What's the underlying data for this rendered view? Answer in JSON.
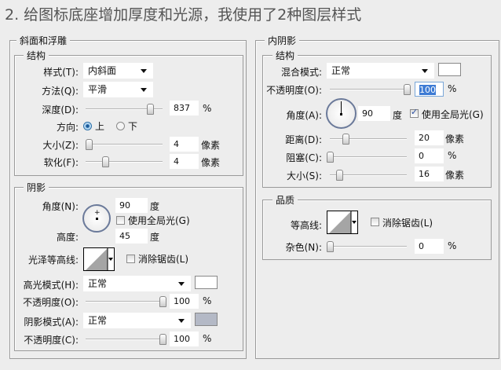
{
  "title": "2. 给图标底座增加厚度和光源，我使用了2种图层样式",
  "left": {
    "legend": "斜面和浮雕",
    "structure": {
      "legend": "结构",
      "style_label": "样式(T):",
      "style_value": "内斜面",
      "technique_label": "方法(Q):",
      "technique_value": "平滑",
      "depth_label": "深度(D):",
      "depth_value": "837",
      "depth_unit": "%",
      "depth_level": 0.84,
      "direction_label": "方向:",
      "direction_up": "上",
      "direction_down": "下",
      "direction_selected": "上",
      "size_label": "大小(Z):",
      "size_value": "4",
      "size_unit": "像素",
      "size_level": 0.04,
      "soften_label": "软化(F):",
      "soften_value": "4",
      "soften_unit": "像素",
      "soften_level": 0.26
    },
    "shading": {
      "legend": "阴影",
      "angle_label": "角度(N):",
      "angle_value": "90",
      "angle_unit": "度",
      "global_light_label": "使用全局光(G)",
      "global_light_checked": false,
      "altitude_label": "高度:",
      "altitude_value": "45",
      "altitude_unit": "度",
      "gloss_contour_label": "光泽等高线:",
      "antialias_label": "消除锯齿(L)",
      "antialias_checked": false,
      "highlight_mode_label": "高光模式(H):",
      "highlight_mode_value": "正常",
      "highlight_color": "#ffffff",
      "highlight_opacity_label": "不透明度(O):",
      "highlight_opacity_value": "100",
      "highlight_opacity_unit": "%",
      "highlight_opacity_level": 1.0,
      "shadow_mode_label": "阴影模式(A):",
      "shadow_mode_value": "正常",
      "shadow_color": "#b4b9c6",
      "shadow_opacity_label": "不透明度(C):",
      "shadow_opacity_value": "100",
      "shadow_opacity_unit": "%",
      "shadow_opacity_level": 1.0
    }
  },
  "right": {
    "legend": "内阴影",
    "structure": {
      "legend": "结构",
      "blend_label": "混合模式:",
      "blend_value": "正常",
      "blend_color": "#ffffff",
      "opacity_label": "不透明度(O):",
      "opacity_value": "100",
      "opacity_unit": "%",
      "opacity_level": 1.0,
      "angle_label": "角度(A):",
      "angle_value": "90",
      "angle_unit": "度",
      "global_light_label": "使用全局光(G)",
      "global_light_checked": true,
      "distance_label": "距离(D):",
      "distance_value": "20",
      "distance_unit": "像素",
      "distance_level": 0.2,
      "choke_label": "阻塞(C):",
      "choke_value": "0",
      "choke_unit": "%",
      "choke_level": 0,
      "size_label": "大小(S):",
      "size_value": "16",
      "size_unit": "像素",
      "size_level": 0.12
    },
    "quality": {
      "legend": "品质",
      "contour_label": "等高线:",
      "antialias_label": "消除锯齿(L)",
      "antialias_checked": false,
      "noise_label": "杂色(N):",
      "noise_value": "0",
      "noise_unit": "%",
      "noise_level": 0
    }
  }
}
